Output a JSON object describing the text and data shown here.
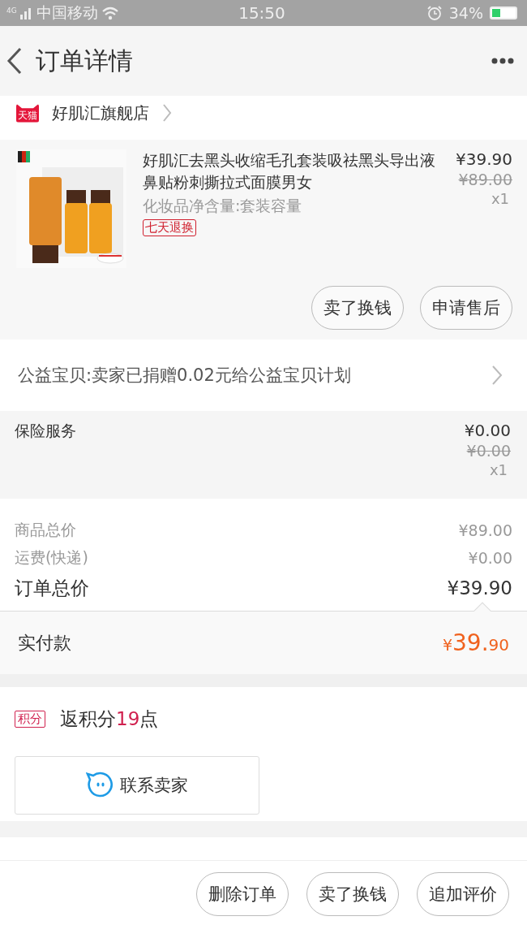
{
  "status_bar": {
    "network": "4G",
    "carrier": "中国移动",
    "time": "15:50",
    "battery": "34%"
  },
  "header": {
    "title": "订单详情"
  },
  "store": {
    "logo": "天猫",
    "name": "好肌汇旗舰店"
  },
  "product": {
    "kind": "picture",
    "title": "好肌汇去黑头收缩毛孔套装吸祛黑头导出液鼻贴粉刺撕拉式面膜男女",
    "spec": "化妆品净含量:套装容量",
    "tag": "七天退换",
    "price": "¥39.90",
    "original_price": "¥89.00",
    "quantity": "x1",
    "actions": [
      "卖了换钱",
      "申请售后"
    ]
  },
  "charity": {
    "text": "公益宝贝:卖家已捐赠0.02元给公益宝贝计划"
  },
  "insurance": {
    "label": "保险服务",
    "price": "¥0.00",
    "original_price": "¥0.00",
    "quantity": "x1"
  },
  "totals": [
    {
      "label": "商品总价",
      "value": "¥89.00",
      "kind": "minor"
    },
    {
      "label": "运费(快递)",
      "value": "¥0.00",
      "kind": "minor"
    },
    {
      "label": "订单总价",
      "value": "¥39.90",
      "kind": "major"
    }
  ],
  "paid": {
    "label": "实付款",
    "currency": "¥",
    "integer": "39.",
    "decimal": "90"
  },
  "points": {
    "badge": "积分",
    "prefix": "返积分",
    "value": "19",
    "suffix": "点"
  },
  "contact": {
    "label": "联系卖家"
  },
  "bottom_actions": [
    "删除订单",
    "卖了换钱",
    "追加评价"
  ]
}
